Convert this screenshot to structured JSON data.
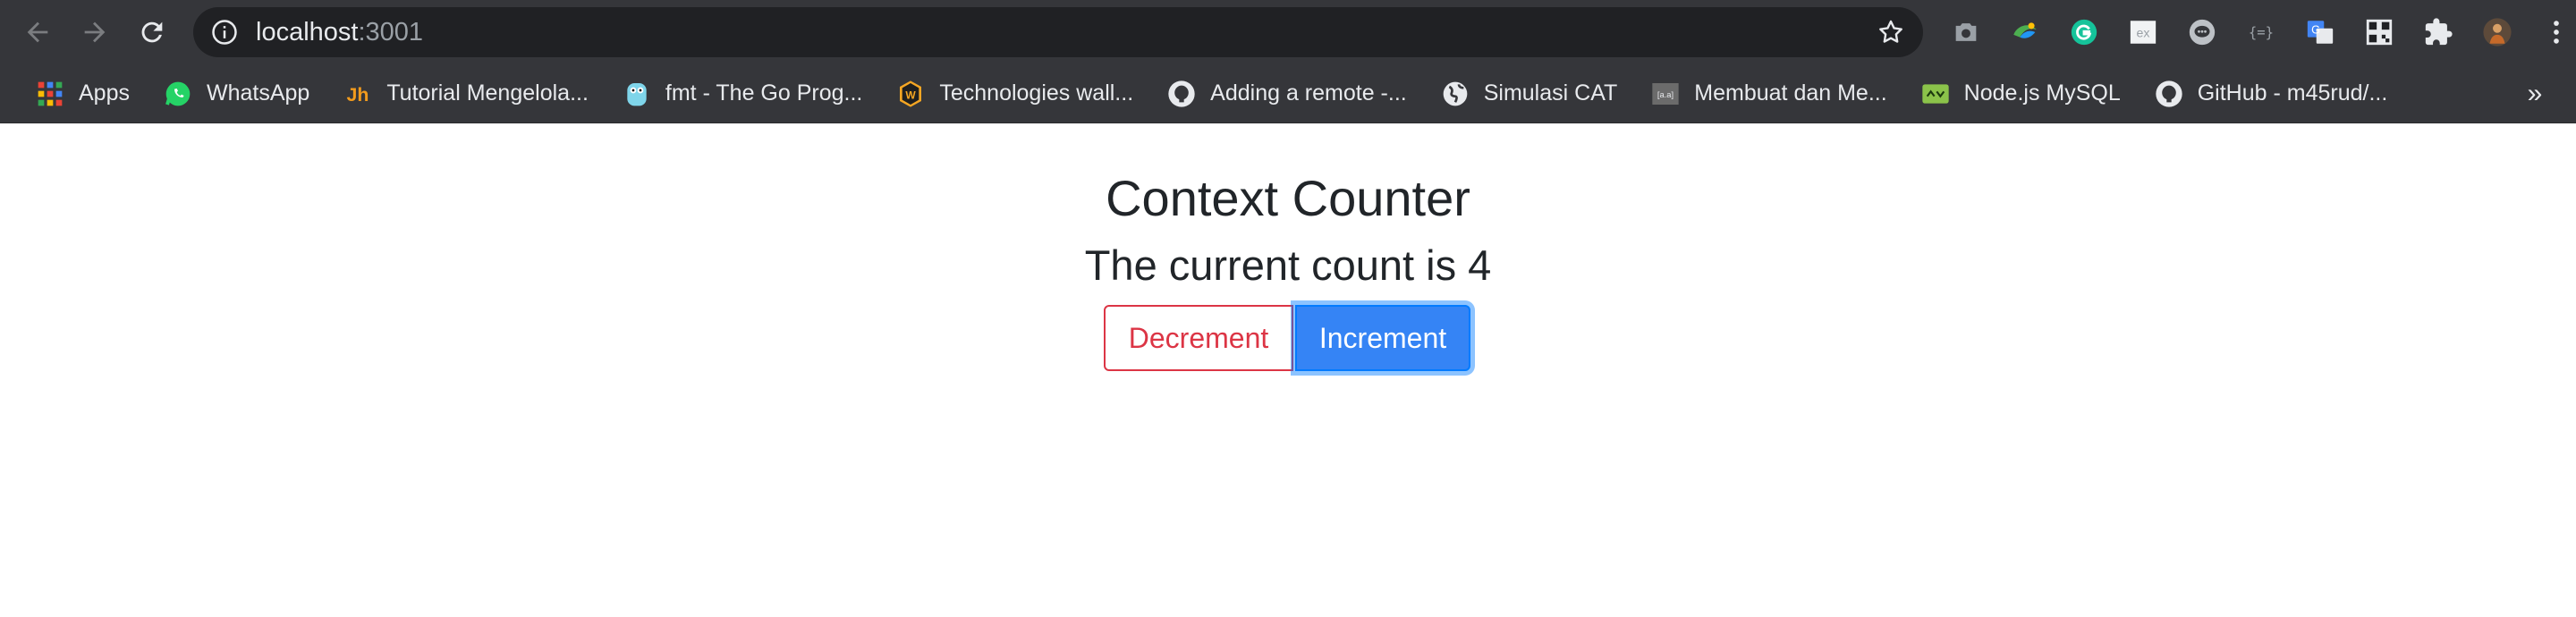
{
  "browser": {
    "url_host": "localhost",
    "url_port": ":3001",
    "bookmarks": [
      {
        "label": "Apps",
        "icon": "apps-grid-icon"
      },
      {
        "label": "WhatsApp",
        "icon": "whatsapp-icon"
      },
      {
        "label": "Tutorial Mengelola...",
        "icon": "jh-logo-icon"
      },
      {
        "label": "fmt - The Go Prog...",
        "icon": "go-gopher-icon"
      },
      {
        "label": "Technologies wall...",
        "icon": "w-badge-icon"
      },
      {
        "label": "Adding a remote -...",
        "icon": "github-icon"
      },
      {
        "label": "Simulasi CAT",
        "icon": "globe-icon"
      },
      {
        "label": "Membuat dan Me...",
        "icon": "site-favicon-icon"
      },
      {
        "label": "Node.js MySQL",
        "icon": "nodejs-icon"
      },
      {
        "label": "GitHub - m45rud/...",
        "icon": "github-icon"
      }
    ],
    "more_label": "»"
  },
  "app": {
    "title": "Context Counter",
    "count_text": "The current count is 4",
    "decrement_label": "Decrement",
    "increment_label": "Increment"
  },
  "colors": {
    "chrome_bg": "#35363a",
    "omnibox_bg": "#202124",
    "danger": "#dc3545",
    "primary": "#3584f5"
  }
}
